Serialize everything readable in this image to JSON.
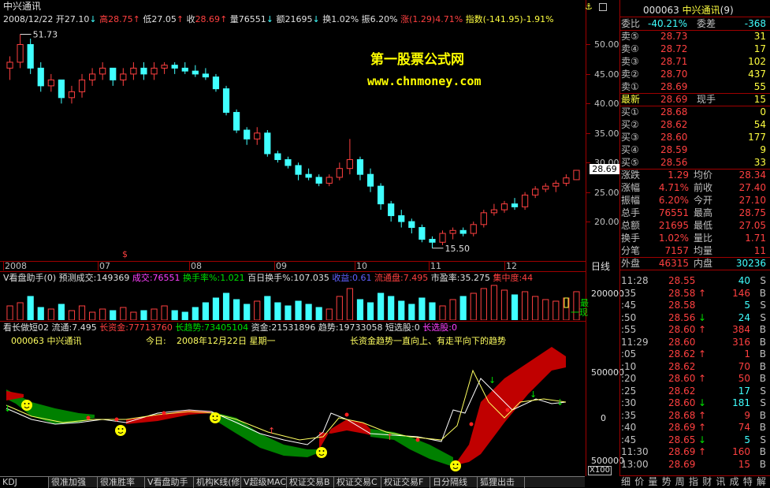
{
  "main_chart": {
    "title": "中兴通讯",
    "ohlc_bar": {
      "date": "2008/12/22",
      "open_label": "开",
      "open": "27.10",
      "high_label": "高",
      "high": "28.75",
      "low_label": "低",
      "low": "27.05",
      "close_label": "收",
      "close": "28.69",
      "vol_label": "量",
      "vol": "76551",
      "amount_label": "额",
      "amount": "21695",
      "turnover_label": "换",
      "turnover": "1.02%",
      "amplitude_label": "振",
      "amplitude": "6.20%",
      "change_label": "涨",
      "change": "(1.29)4.71%",
      "index_label": "指数",
      "index": "(-141.95)-1.91%"
    },
    "price_max_label": "51.73",
    "price_min_label": "15.50",
    "current_price_tag": "28.69",
    "y_ticks": [
      "50.00",
      "45.00",
      "40.00",
      "35.00",
      "30.00",
      "25.00",
      "20.00"
    ],
    "x_ticks": [
      "2008",
      "07",
      "08",
      "09",
      "10",
      "11",
      "12"
    ],
    "x_marker": "$",
    "watermark_title": "第一股票公式网",
    "watermark_url": "www.chnmoney.com",
    "right_label": "日线"
  },
  "volume_panel": {
    "indicator": "V看盘助手(0)",
    "items": [
      {
        "label": "预测成交:",
        "value": "149369",
        "color": "#e0e0e0"
      },
      {
        "label": "成交:",
        "value": "76551",
        "color": "#ff40ff"
      },
      {
        "label": "换手率%:",
        "value": "1.021",
        "color": "#00e000"
      },
      {
        "label": "百日换手%:",
        "value": "107.035",
        "color": "#e0e0e0"
      },
      {
        "label": "收益:",
        "value": "0.61",
        "color": "#6060ff"
      },
      {
        "label": "流通盘:",
        "value": "7.495",
        "color": "#ff4040"
      },
      {
        "label": "市盈率:",
        "value": "35.275",
        "color": "#e0e0e0"
      },
      {
        "label": "集中度:",
        "value": "44",
        "color": "#ff4040"
      }
    ],
    "y_tick": "200000",
    "side_labels": [
      "最",
      "一现"
    ]
  },
  "trend_panel": {
    "indicator": "看长做短02",
    "items": [
      {
        "label": "流通:",
        "value": "7.495",
        "color": "#e0e0e0"
      },
      {
        "label": "长资金:",
        "value": "77713760",
        "color": "#ff4040"
      },
      {
        "label": "长趋势:",
        "value": "73405104",
        "color": "#00e000"
      },
      {
        "label": "资金:",
        "value": "21531896",
        "color": "#e0e0e0"
      },
      {
        "label": "趋势:",
        "value": "19733058",
        "color": "#e0e0e0"
      },
      {
        "label": "短选股:",
        "value": "0",
        "color": "#e0e0e0"
      },
      {
        "label": "长选股:",
        "value": "0",
        "color": "#ff40ff"
      }
    ],
    "code_line": "000063 中兴通讯",
    "today_label": "今日:",
    "today_value": "2008年12月22日 星期一",
    "trend_note": "长资金趋势一直向上、有走平向下的趋势",
    "y_ticks": [
      "500000",
      "0",
      "500000"
    ],
    "scale_label": "X100"
  },
  "tabs": [
    "KDJ",
    "很准加强",
    "很准胜率",
    "V看盘助手",
    "机构K线(修)",
    "V超级MACD",
    "权证交易B",
    "权证交易C",
    "权证交易F",
    "日分隔线",
    "狐狸出击"
  ],
  "right_panel": {
    "code": "000063",
    "name": "中兴通讯",
    "suffix": "(9)",
    "webi_label": "委比",
    "webi_value": "-40.21%",
    "wecha_label": "委差",
    "wecha_value": "-368",
    "asks": [
      {
        "label": "卖⑤",
        "price": "28.73",
        "vol": "31"
      },
      {
        "label": "卖④",
        "price": "28.72",
        "vol": "17"
      },
      {
        "label": "卖③",
        "price": "28.71",
        "vol": "102"
      },
      {
        "label": "卖②",
        "price": "28.70",
        "vol": "437"
      },
      {
        "label": "卖①",
        "price": "28.69",
        "vol": "55"
      }
    ],
    "last_label": "最新",
    "last_value": "28.69",
    "now_label": "现手",
    "now_value": "15",
    "bids": [
      {
        "label": "买①",
        "price": "28.68",
        "vol": "0"
      },
      {
        "label": "买②",
        "price": "28.62",
        "vol": "54"
      },
      {
        "label": "买③",
        "price": "28.60",
        "vol": "177"
      },
      {
        "label": "买④",
        "price": "28.59",
        "vol": "9"
      },
      {
        "label": "买⑤",
        "price": "28.56",
        "vol": "33"
      }
    ],
    "stats": [
      {
        "l1": "涨跌",
        "v1": "1.29",
        "l2": "均价",
        "v2": "28.34"
      },
      {
        "l1": "涨幅",
        "v1": "4.71%",
        "l2": "前收",
        "v2": "27.40"
      },
      {
        "l1": "振幅",
        "v1": "6.20%",
        "l2": "今开",
        "v2": "27.10"
      },
      {
        "l1": "总手",
        "v1": "76551",
        "l2": "最高",
        "v2": "28.75"
      },
      {
        "l1": "总额",
        "v1": "21695",
        "l2": "最低",
        "v2": "27.05"
      },
      {
        "l1": "换手",
        "v1": "1.02%",
        "l2": "量比",
        "v2": "1.71"
      },
      {
        "l1": "分笔",
        "v1": "7157",
        "l2": "均量",
        "v2": "11"
      },
      {
        "l1": "外盘",
        "v1": "46315",
        "l2": "内盘",
        "v2": "30236"
      }
    ],
    "ticks": [
      {
        "time": "11:28",
        "price": "28.55",
        "vol": "40",
        "dir": "",
        "side": "S"
      },
      {
        "time": ":35",
        "price": "28.58",
        "vol": "146",
        "dir": "up",
        "side": "B"
      },
      {
        "time": ":45",
        "price": "28.58",
        "vol": "5",
        "dir": "",
        "side": "S"
      },
      {
        "time": ":50",
        "price": "28.56",
        "vol": "24",
        "dir": "down",
        "side": "S"
      },
      {
        "time": ":55",
        "price": "28.60",
        "vol": "384",
        "dir": "up",
        "side": "B"
      },
      {
        "time": "11:29",
        "price": "28.60",
        "vol": "316",
        "dir": "",
        "side": "B"
      },
      {
        "time": ":05",
        "price": "28.62",
        "vol": "1",
        "dir": "up",
        "side": "B"
      },
      {
        "time": ":10",
        "price": "28.62",
        "vol": "70",
        "dir": "",
        "side": "B"
      },
      {
        "time": ":20",
        "price": "28.60",
        "vol": "50",
        "dir": "up",
        "side": "B"
      },
      {
        "time": ":25",
        "price": "28.62",
        "vol": "17",
        "dir": "",
        "side": "S"
      },
      {
        "time": ":30",
        "price": "28.60",
        "vol": "181",
        "dir": "down",
        "side": "S"
      },
      {
        "time": ":35",
        "price": "28.68",
        "vol": "9",
        "dir": "up",
        "side": "B"
      },
      {
        "time": ":40",
        "price": "28.69",
        "vol": "74",
        "dir": "up",
        "side": "B"
      },
      {
        "time": ":45",
        "price": "28.65",
        "vol": "5",
        "dir": "down",
        "side": "S"
      },
      {
        "time": "11:30",
        "price": "28.69",
        "vol": "160",
        "dir": "up",
        "side": "B"
      },
      {
        "time": "13:00",
        "price": "28.69",
        "vol": "15",
        "dir": "",
        "side": "B"
      }
    ],
    "bottom_menu": [
      "细",
      "价",
      "量",
      "势",
      "周",
      "指",
      "财",
      "讯",
      "成",
      "特",
      "解"
    ]
  },
  "colors": {
    "up": "#ff4040",
    "down": "#40ffff",
    "frame": "#a00000"
  },
  "chart_data": {
    "type": "candlestick",
    "title": "中兴通讯",
    "ylim": [
      14,
      53
    ],
    "y_ticks": [
      20,
      25,
      30,
      35,
      40,
      45,
      50
    ],
    "x_labels": [
      "2008",
      "07",
      "08",
      "09",
      "10",
      "11",
      "12"
    ],
    "ohlc": [
      [
        46,
        48,
        44,
        47
      ],
      [
        47,
        51.73,
        46,
        50
      ],
      [
        50,
        51,
        45,
        46
      ],
      [
        46,
        47,
        42,
        43
      ],
      [
        43,
        45,
        42,
        44
      ],
      [
        44,
        44,
        40,
        41
      ],
      [
        41,
        43,
        40,
        42
      ],
      [
        42,
        45,
        41,
        44
      ],
      [
        44,
        46,
        43,
        45
      ],
      [
        45,
        47,
        44,
        46
      ],
      [
        46,
        46,
        43,
        44
      ],
      [
        44,
        46,
        43,
        45
      ],
      [
        45,
        47,
        44,
        46
      ],
      [
        46,
        47,
        44,
        45
      ],
      [
        45,
        47,
        44,
        46
      ],
      [
        46,
        47,
        45,
        46.5
      ],
      [
        46.5,
        47,
        45,
        46
      ],
      [
        46,
        47,
        45,
        45.5
      ],
      [
        45.5,
        46.5,
        44.5,
        45
      ],
      [
        45,
        46,
        44,
        44.5
      ],
      [
        44.5,
        45,
        42,
        42.5
      ],
      [
        42.5,
        43,
        38,
        38.5
      ],
      [
        38.5,
        39,
        35,
        35.5
      ],
      [
        35.5,
        36,
        33,
        34
      ],
      [
        34,
        36,
        33,
        35
      ],
      [
        35,
        35.5,
        31,
        31.5
      ],
      [
        31.5,
        32,
        30,
        30.5
      ],
      [
        30.5,
        31,
        29,
        29.5
      ],
      [
        29.5,
        30,
        27,
        28
      ],
      [
        28,
        29,
        27,
        27.5
      ],
      [
        27.5,
        28,
        26,
        26.5
      ],
      [
        26.5,
        28,
        26,
        27.5
      ],
      [
        27.5,
        30,
        27,
        29
      ],
      [
        29,
        34,
        28,
        30.5
      ],
      [
        30.5,
        31,
        27,
        28
      ],
      [
        28,
        29,
        25,
        26
      ],
      [
        26,
        26.5,
        22,
        23
      ],
      [
        23,
        23.5,
        20,
        21
      ],
      [
        21,
        22,
        19,
        20
      ],
      [
        20,
        20.5,
        18,
        19
      ],
      [
        19,
        19.5,
        16.5,
        17
      ],
      [
        17,
        17.5,
        15.5,
        16.5
      ],
      [
        16.5,
        18.5,
        16,
        18
      ],
      [
        18,
        19,
        17,
        18.5
      ],
      [
        18.5,
        19,
        17.5,
        18
      ],
      [
        18,
        20,
        17.5,
        19.5
      ],
      [
        19.5,
        22,
        19,
        21.5
      ],
      [
        21.5,
        23,
        21,
        22
      ],
      [
        22,
        23.5,
        21.5,
        23
      ],
      [
        23,
        24,
        22,
        22.5
      ],
      [
        22.5,
        25,
        22,
        24.5
      ],
      [
        24.5,
        26,
        24,
        25.5
      ],
      [
        25.5,
        26.5,
        25,
        26
      ],
      [
        26,
        27,
        25,
        26.5
      ],
      [
        26.5,
        28,
        26,
        27.4
      ],
      [
        27.1,
        28.75,
        27.05,
        28.69
      ]
    ]
  }
}
